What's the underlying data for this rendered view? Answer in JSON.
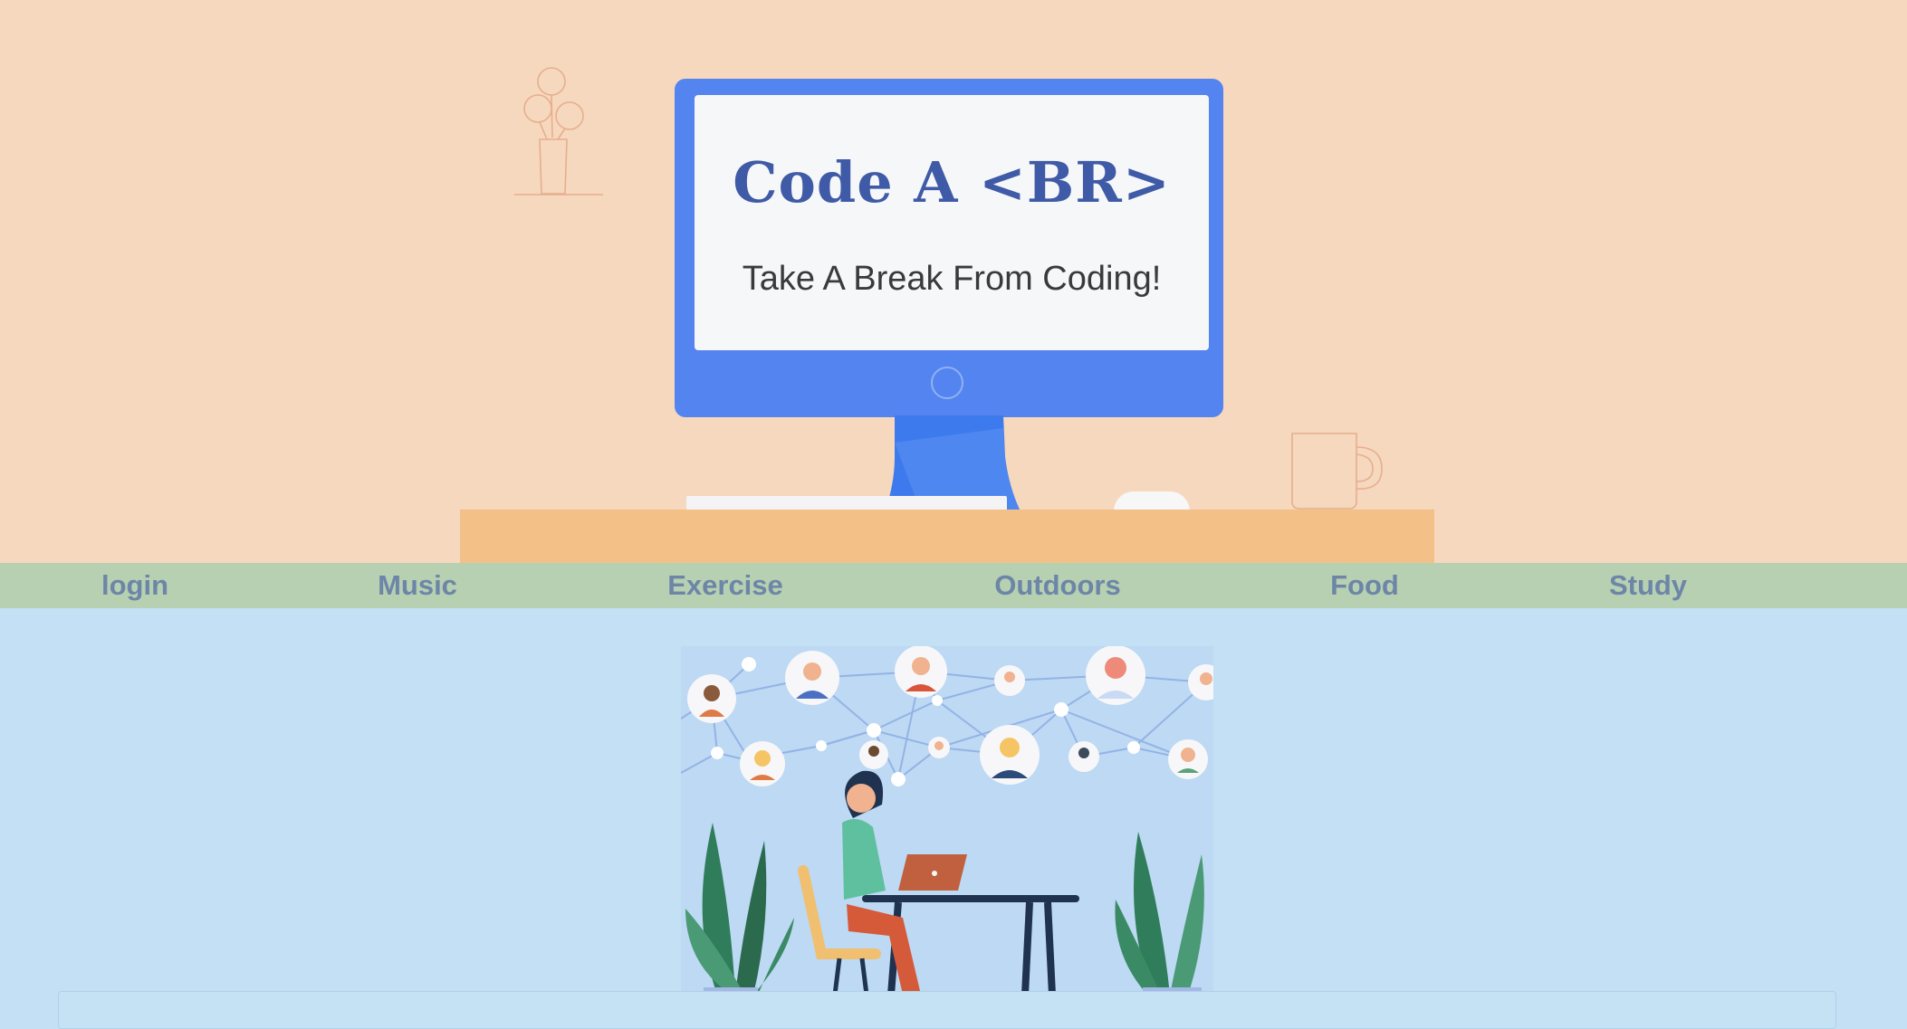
{
  "hero": {
    "title": "Code A <BR>",
    "subtitle": "Take A Break From Coding!"
  },
  "nav": {
    "items": [
      {
        "label": "login"
      },
      {
        "label": "Music"
      },
      {
        "label": "Exercise"
      },
      {
        "label": "Outdoors"
      },
      {
        "label": "Food"
      },
      {
        "label": "Study"
      }
    ]
  },
  "colors": {
    "hero_background": "#f5d8bd",
    "monitor": "#5484ef",
    "desk": "#f3c088",
    "nav_background": "#b6d0b1",
    "nav_text": "#6d86a8",
    "main_background": "#c3e0f4",
    "title_text": "#3f5aa6"
  },
  "icons": [
    "flower-vase-icon",
    "monitor-icon",
    "keyboard-icon",
    "mouse-icon",
    "mug-icon"
  ]
}
